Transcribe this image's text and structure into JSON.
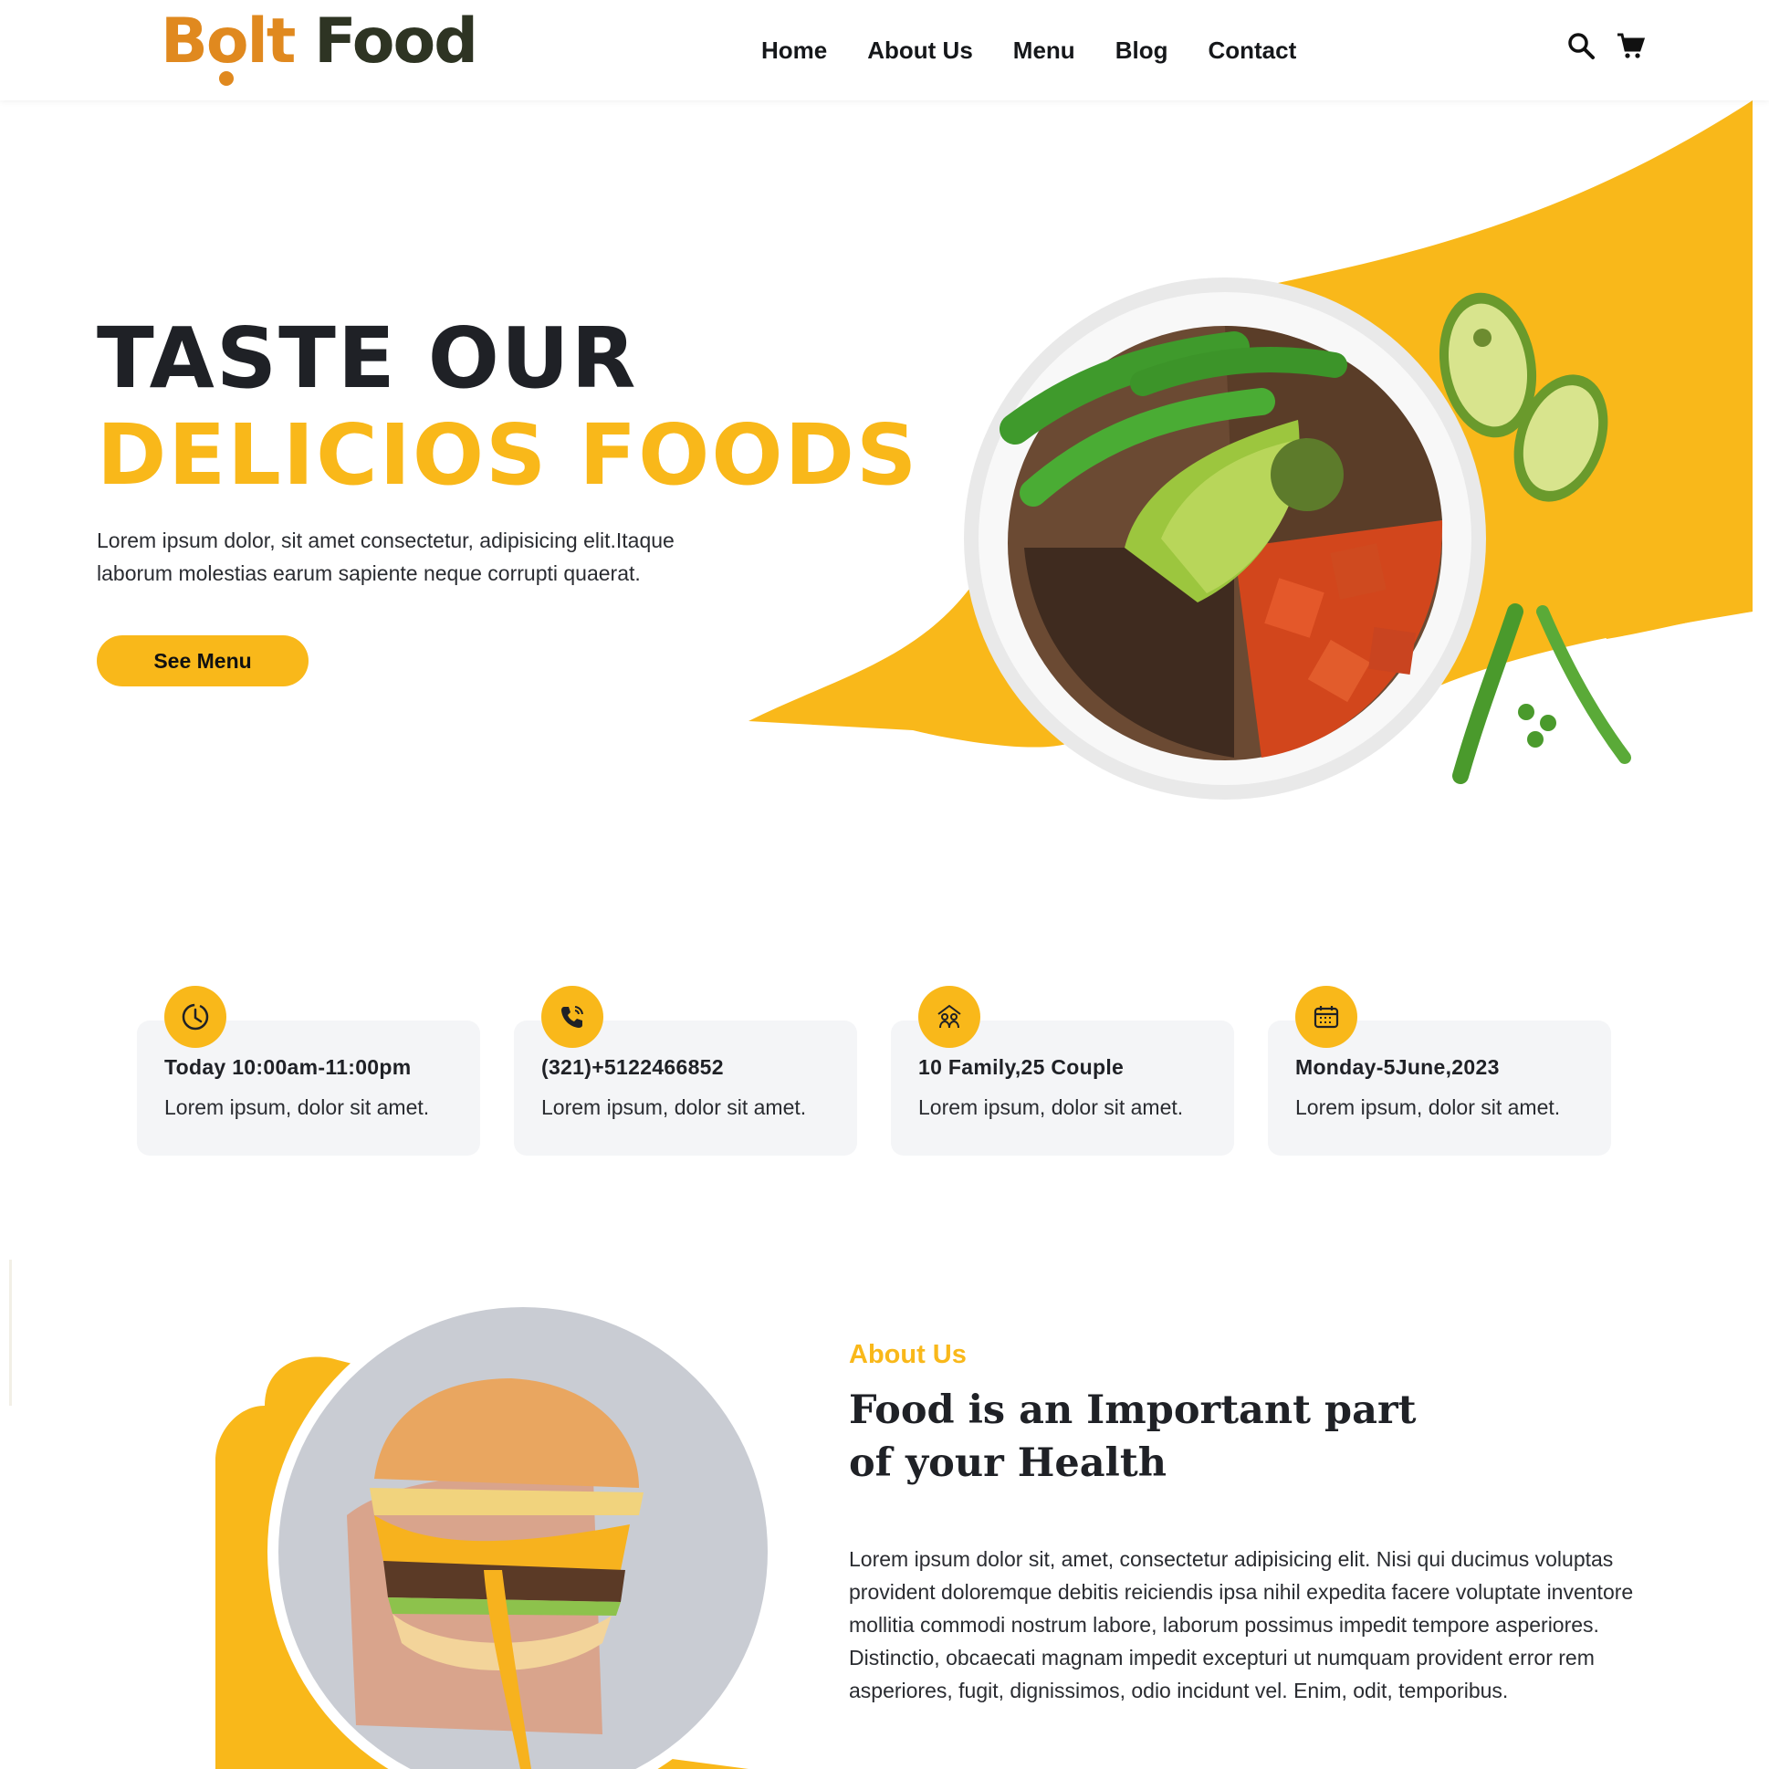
{
  "brand": {
    "name_part1": "Bolt",
    "name_part2": "Food"
  },
  "nav": {
    "items": [
      "Home",
      "About Us",
      "Menu",
      "Blog",
      "Contact"
    ]
  },
  "header_icons": [
    "search-icon",
    "cart-icon"
  ],
  "hero": {
    "title_line1": "TASTE OUR",
    "title_line2": "DELICIOS FOODS",
    "description": "Lorem ipsum dolor, sit amet consectetur, adipisicing elit.Itaque laborum molestias earum sapiente neque corrupti quaerat.",
    "button_label": "See Menu"
  },
  "info_cards": [
    {
      "icon": "clock-icon",
      "title": "Today 10:00am-11:00pm",
      "desc": "Lorem ipsum, dolor sit amet."
    },
    {
      "icon": "phone-icon",
      "title": "(321)+5122466852",
      "desc": "Lorem ipsum, dolor sit amet."
    },
    {
      "icon": "family-icon",
      "title": "10 Family,25 Couple",
      "desc": "Lorem ipsum, dolor sit amet."
    },
    {
      "icon": "calendar-icon",
      "title": "Monday-5June,2023",
      "desc": "Lorem ipsum, dolor sit amet."
    }
  ],
  "about": {
    "label": "About Us",
    "title": "Food is an Important part of your Health",
    "text": "Lorem ipsum dolor sit, amet, consectetur adipisicing elit. Nisi qui ducimus voluptas provident doloremque debitis reiciendis ipsa nihil expedita facere voluptate inventore mollitia commodi nostrum labore, laborum possimus impedit tempore asperiores. Distinctio, obcaecati magnam impedit excepturi ut numquam provident error rem asperiores, fugit, dignissimos, odio incidunt vel. Enim, odit, temporibus."
  },
  "colors": {
    "accent": "#f9b81a",
    "logo_orange": "#e0891f",
    "logo_dark": "#2e3423",
    "text_dark": "#1f2126",
    "card_bg": "#f4f5f7"
  }
}
